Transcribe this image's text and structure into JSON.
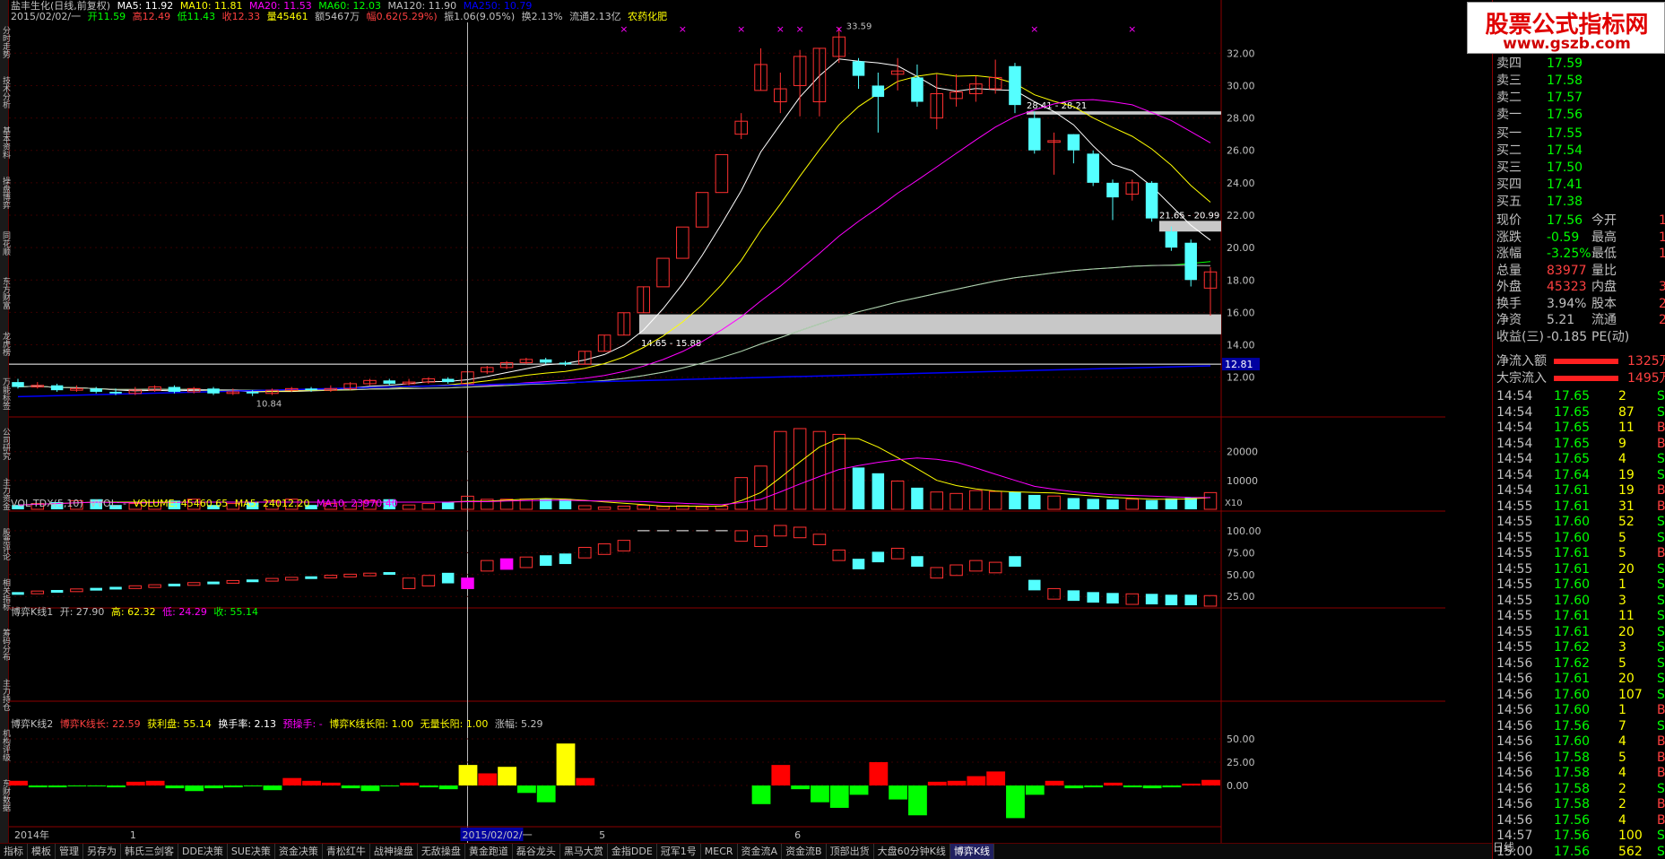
{
  "window": {
    "title": "盐丰生化(日线,前复权)"
  },
  "info_line": {
    "ma5": "MA5: 11.92",
    "ma10": "MA10: 11.81",
    "ma20": "MA20: 11.53",
    "ma60": "MA60: 12.03",
    "ma120": "MA120: 11.90",
    "ma250": "MA250: 10.79"
  },
  "info_line2": {
    "date": "2015/02/02/一",
    "open": "开11.59",
    "high": "高12.49",
    "low": "低11.43",
    "close": "收12.33",
    "vol": "量45461",
    "amount": "额5467万",
    "change": "幅0.62(5.29%)",
    "amplitude": "振1.06(9.05%)",
    "turnover": "换2.13%",
    "float": "流通2.13亿",
    "sector": "农药化肥"
  },
  "main_chart": {
    "axis_labels": [
      "32.00",
      "30.00",
      "28.00",
      "26.00",
      "24.00",
      "22.00",
      "20.00",
      "18.00",
      "16.00",
      "14.00",
      "12.00"
    ],
    "price_tag": "12.81",
    "annotations": {
      "high": "33.59",
      "low": "10.84",
      "band1": "28.41 - 28.21",
      "band2": "21.65 - 20.99",
      "band3": "14.65 - 15.88"
    }
  },
  "vol_panel": {
    "header": {
      "name": "VOL-TDX(5,10)",
      "vvol": "VVOL: -",
      "volume": "VOLUME: 45460.65",
      "ma5": "MA5: 24012.20",
      "ma10": "MA10: 23970.40"
    },
    "axis_labels": [
      "20000",
      "10000"
    ],
    "unit": "X10"
  },
  "kline1_panel": {
    "header": {
      "name": "博弈K线1",
      "open": "开: 27.90",
      "high": "高: 62.32",
      "low": "低: 24.29",
      "close": "收: 55.14"
    },
    "axis_labels": [
      "100.00",
      "75.00",
      "50.00",
      "25.00"
    ]
  },
  "kline2_panel": {
    "header": {
      "name": "博弈K线2",
      "length": "博弈K线长: 22.59",
      "profit": "获利盘: 55.14",
      "turnover": "换手率: 2.13",
      "pre": "预操手: -",
      "long": "博弈K线长阳: 1.00",
      "noline": "无量长阳: 1.00",
      "change": "涨幅: 5.29"
    },
    "axis_labels": [
      "50.00",
      "25.00",
      "0.00"
    ]
  },
  "date_axis": {
    "labels": [
      "2014年",
      "1",
      "2015/02/02/一",
      "5",
      "6"
    ]
  },
  "left_tabs": [
    "分时走势",
    "技术分析",
    "基本资料",
    "操盘博弈",
    "同花顺",
    "东方财富",
    "龙虎榜",
    "万能标签",
    "公司研究",
    "主力资金",
    "股票评论",
    "相关指标",
    "筹码分布",
    "主力持仓",
    "机构评级",
    "东财数据"
  ],
  "bottom_tabs": [
    "指标",
    "模板",
    "管理",
    "另存为",
    "韩氏三剑客",
    "DDE决策",
    "SUE决策",
    "资金决策",
    "青松红牛",
    "战神操盘",
    "无敌操盘",
    "黄金跑道",
    "磊谷龙头",
    "黑马大赏",
    "金指DDE",
    "冠军1号",
    "MECR",
    "资金流A",
    "资金流B",
    "顶部出货",
    "大盘60分钟K线",
    "博弈K线"
  ],
  "active_bottom_tab": "博弈K线",
  "logo": {
    "title": "股票公式指标网",
    "url": "www.gszb.com"
  },
  "quote": {
    "sell": [
      {
        "label": "卖四",
        "price": "17.59"
      },
      {
        "label": "卖三",
        "price": "17.58"
      },
      {
        "label": "卖二",
        "price": "17.57"
      },
      {
        "label": "卖一",
        "price": "17.56"
      }
    ],
    "buy": [
      {
        "label": "买一",
        "price": "17.55"
      },
      {
        "label": "买二",
        "price": "17.54"
      },
      {
        "label": "买三",
        "price": "17.50"
      },
      {
        "label": "买四",
        "price": "17.41"
      },
      {
        "label": "买五",
        "price": "17.38"
      }
    ],
    "stats": [
      {
        "l1": "现价",
        "v1": "17.56",
        "l2": "今开",
        "v2": "1"
      },
      {
        "l1": "涨跌",
        "v1": "-0.59",
        "l2": "最高",
        "v2": "1"
      },
      {
        "l1": "涨幅",
        "v1": "-3.25%",
        "l2": "最低",
        "v2": "1"
      },
      {
        "l1": "总量",
        "v1": "83977",
        "l2": "量比",
        "v2": ""
      },
      {
        "l1": "外盘",
        "v1": "45323",
        "l2": "内盘",
        "v2": "3"
      },
      {
        "l1": "换手",
        "v1": "3.94%",
        "l2": "股本",
        "v2": "2."
      },
      {
        "l1": "净资",
        "v1": "5.21",
        "l2": "流通",
        "v2": "2."
      },
      {
        "l1": "收益(三)",
        "v1": "-0.185",
        "l2": "PE(动)",
        "v2": ""
      }
    ],
    "flows": [
      {
        "label": "净流入额",
        "value": "1325万"
      },
      {
        "label": "大宗流入",
        "value": "1495万"
      }
    ],
    "ticks": [
      {
        "t": "14:54",
        "p": "17.65",
        "v": "2",
        "bs": "S"
      },
      {
        "t": "14:54",
        "p": "17.65",
        "v": "87",
        "bs": "S"
      },
      {
        "t": "14:54",
        "p": "17.65",
        "v": "11",
        "bs": "B"
      },
      {
        "t": "14:54",
        "p": "17.65",
        "v": "9",
        "bs": "B"
      },
      {
        "t": "14:54",
        "p": "17.65",
        "v": "4",
        "bs": "S"
      },
      {
        "t": "14:54",
        "p": "17.64",
        "v": "19",
        "bs": "S"
      },
      {
        "t": "14:54",
        "p": "17.61",
        "v": "19",
        "bs": "B"
      },
      {
        "t": "14:55",
        "p": "17.61",
        "v": "31",
        "bs": "B"
      },
      {
        "t": "14:55",
        "p": "17.60",
        "v": "52",
        "bs": "S"
      },
      {
        "t": "14:55",
        "p": "17.60",
        "v": "5",
        "bs": "S"
      },
      {
        "t": "14:55",
        "p": "17.61",
        "v": "5",
        "bs": "B"
      },
      {
        "t": "14:55",
        "p": "17.61",
        "v": "20",
        "bs": "S"
      },
      {
        "t": "14:55",
        "p": "17.60",
        "v": "1",
        "bs": "S"
      },
      {
        "t": "14:55",
        "p": "17.60",
        "v": "3",
        "bs": "S"
      },
      {
        "t": "14:55",
        "p": "17.61",
        "v": "11",
        "bs": "S"
      },
      {
        "t": "14:55",
        "p": "17.61",
        "v": "20",
        "bs": "S"
      },
      {
        "t": "14:55",
        "p": "17.62",
        "v": "3",
        "bs": "S"
      },
      {
        "t": "14:56",
        "p": "17.62",
        "v": "5",
        "bs": "S"
      },
      {
        "t": "14:56",
        "p": "17.61",
        "v": "20",
        "bs": "S"
      },
      {
        "t": "14:56",
        "p": "17.60",
        "v": "107",
        "bs": "S"
      },
      {
        "t": "14:56",
        "p": "17.60",
        "v": "1",
        "bs": "B"
      },
      {
        "t": "14:56",
        "p": "17.56",
        "v": "7",
        "bs": "S"
      },
      {
        "t": "14:56",
        "p": "17.60",
        "v": "4",
        "bs": "B"
      },
      {
        "t": "14:56",
        "p": "17.58",
        "v": "5",
        "bs": "B"
      },
      {
        "t": "14:56",
        "p": "17.58",
        "v": "4",
        "bs": "B"
      },
      {
        "t": "14:56",
        "p": "17.58",
        "v": "2",
        "bs": "S"
      },
      {
        "t": "14:56",
        "p": "17.58",
        "v": "2",
        "bs": "B"
      },
      {
        "t": "14:56",
        "p": "17.56",
        "v": "4",
        "bs": "B"
      },
      {
        "t": "14:57",
        "p": "17.56",
        "v": "100",
        "bs": "S"
      },
      {
        "t": "15:00",
        "p": "17.56",
        "v": "562",
        "bs": "S"
      }
    ],
    "period": "日线"
  },
  "chart_data": {
    "type": "candlestick",
    "candles": [
      [
        11.7,
        11.4,
        11.9,
        11.3
      ],
      [
        11.4,
        11.5,
        11.7,
        11.3
      ],
      [
        11.5,
        11.2,
        11.6,
        11.1
      ],
      [
        11.2,
        11.3,
        11.5,
        11.1
      ],
      [
        11.3,
        11.1,
        11.4,
        11.0
      ],
      [
        11.1,
        11.0,
        11.3,
        10.9
      ],
      [
        11.0,
        11.2,
        11.4,
        10.9
      ],
      [
        11.2,
        11.4,
        11.5,
        11.1
      ],
      [
        11.4,
        11.1,
        11.5,
        11.0
      ],
      [
        11.1,
        11.3,
        11.4,
        11.0
      ],
      [
        11.3,
        11.0,
        11.4,
        10.9
      ],
      [
        11.0,
        11.1,
        11.3,
        10.9
      ],
      [
        11.1,
        11.0,
        11.2,
        10.84
      ],
      [
        11.0,
        11.2,
        11.3,
        10.9
      ],
      [
        11.2,
        11.3,
        11.4,
        11.1
      ],
      [
        11.3,
        11.2,
        11.4,
        11.1
      ],
      [
        11.2,
        11.3,
        11.5,
        11.1
      ],
      [
        11.3,
        11.6,
        11.7,
        11.2
      ],
      [
        11.6,
        11.8,
        11.9,
        11.5
      ],
      [
        11.8,
        11.6,
        11.9,
        11.5
      ],
      [
        11.6,
        11.7,
        11.9,
        11.5
      ],
      [
        11.7,
        11.9,
        12.0,
        11.6
      ],
      [
        11.9,
        11.7,
        12.0,
        11.6
      ],
      [
        11.59,
        12.33,
        12.49,
        11.43
      ],
      [
        12.33,
        12.6,
        12.7,
        12.2
      ],
      [
        12.6,
        12.9,
        13.0,
        12.5
      ],
      [
        12.9,
        13.1,
        13.2,
        12.8
      ],
      [
        13.1,
        12.9,
        13.2,
        12.8
      ],
      [
        12.9,
        12.8,
        13.0,
        12.7
      ],
      [
        12.8,
        13.6,
        13.6,
        12.8
      ],
      [
        13.6,
        14.6,
        14.6,
        13.6
      ],
      [
        14.6,
        15.98,
        15.98,
        14.6
      ],
      [
        15.98,
        17.58,
        17.58,
        15.98
      ],
      [
        17.58,
        19.34,
        19.34,
        19.34
      ],
      [
        19.34,
        21.27,
        21.27,
        21.27
      ],
      [
        21.27,
        23.4,
        23.4,
        23.4
      ],
      [
        23.4,
        25.74,
        25.74,
        25.74
      ],
      [
        27.0,
        27.8,
        28.3,
        26.7
      ],
      [
        29.7,
        31.3,
        32.3,
        29.7
      ],
      [
        29.0,
        29.8,
        30.8,
        28.3
      ],
      [
        30.0,
        31.8,
        32.2,
        28.1
      ],
      [
        29.0,
        32.3,
        32.3,
        28.1
      ],
      [
        31.8,
        33.0,
        33.59,
        31.4
      ],
      [
        31.5,
        30.6,
        31.7,
        29.8
      ],
      [
        30.0,
        29.3,
        30.8,
        27.1
      ],
      [
        30.7,
        30.9,
        31.7,
        29.7
      ],
      [
        30.5,
        29.0,
        31.3,
        28.7
      ],
      [
        28.0,
        29.5,
        30.7,
        27.3
      ],
      [
        29.2,
        29.6,
        30.7,
        28.7
      ],
      [
        29.5,
        30.1,
        30.6,
        29.0
      ],
      [
        29.8,
        30.5,
        31.6,
        29.5
      ],
      [
        31.2,
        28.8,
        31.4,
        28.3
      ],
      [
        28.0,
        26.0,
        28.4,
        25.8
      ],
      [
        26.5,
        26.6,
        27.1,
        24.5
      ],
      [
        27.0,
        26.0,
        27.0,
        25.2
      ],
      [
        25.8,
        24.0,
        26.0,
        23.8
      ],
      [
        24.0,
        23.1,
        24.2,
        21.7
      ],
      [
        23.3,
        24.0,
        24.2,
        22.9
      ],
      [
        24.0,
        21.8,
        24.1,
        21.6
      ],
      [
        21.0,
        20.0,
        21.3,
        19.8
      ],
      [
        20.3,
        18.0,
        20.5,
        17.6
      ],
      [
        17.5,
        18.5,
        18.8,
        15.8
      ]
    ]
  }
}
